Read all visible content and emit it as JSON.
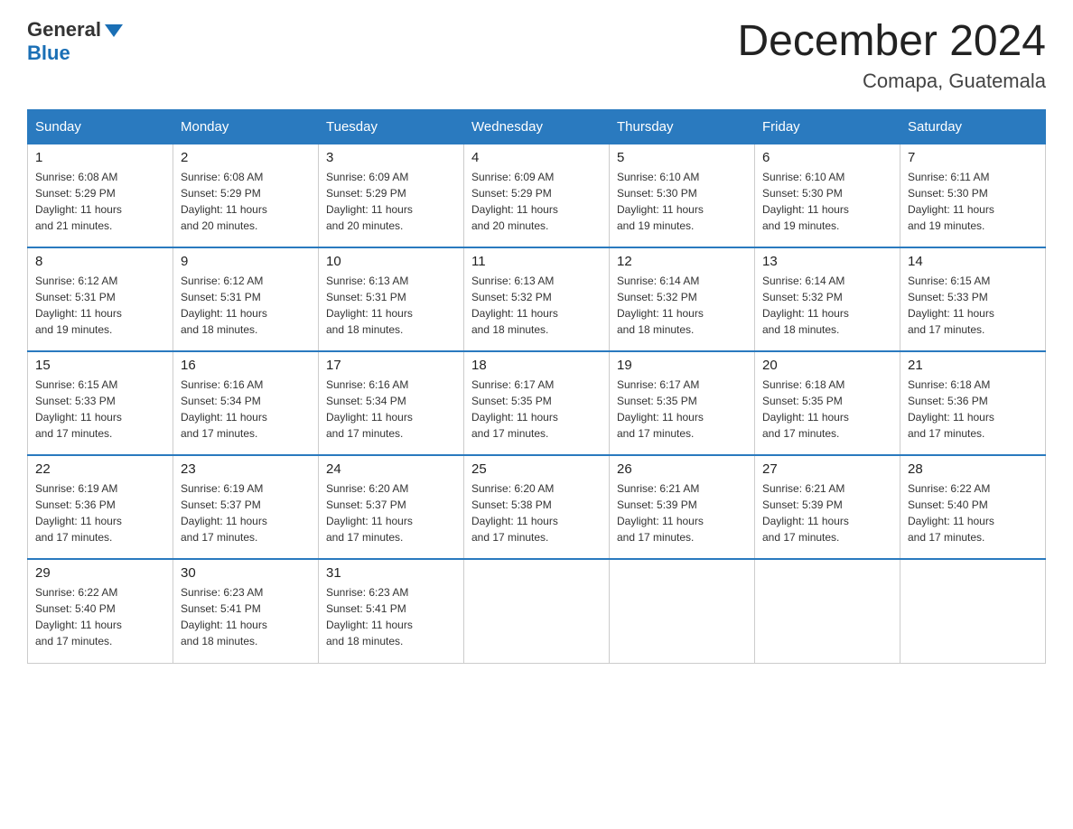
{
  "header": {
    "logo_general": "General",
    "logo_blue": "Blue",
    "month_title": "December 2024",
    "location": "Comapa, Guatemala"
  },
  "weekdays": [
    "Sunday",
    "Monday",
    "Tuesday",
    "Wednesday",
    "Thursday",
    "Friday",
    "Saturday"
  ],
  "weeks": [
    [
      {
        "day": "1",
        "sunrise": "6:08 AM",
        "sunset": "5:29 PM",
        "daylight": "11 hours and 21 minutes."
      },
      {
        "day": "2",
        "sunrise": "6:08 AM",
        "sunset": "5:29 PM",
        "daylight": "11 hours and 20 minutes."
      },
      {
        "day": "3",
        "sunrise": "6:09 AM",
        "sunset": "5:29 PM",
        "daylight": "11 hours and 20 minutes."
      },
      {
        "day": "4",
        "sunrise": "6:09 AM",
        "sunset": "5:29 PM",
        "daylight": "11 hours and 20 minutes."
      },
      {
        "day": "5",
        "sunrise": "6:10 AM",
        "sunset": "5:30 PM",
        "daylight": "11 hours and 19 minutes."
      },
      {
        "day": "6",
        "sunrise": "6:10 AM",
        "sunset": "5:30 PM",
        "daylight": "11 hours and 19 minutes."
      },
      {
        "day": "7",
        "sunrise": "6:11 AM",
        "sunset": "5:30 PM",
        "daylight": "11 hours and 19 minutes."
      }
    ],
    [
      {
        "day": "8",
        "sunrise": "6:12 AM",
        "sunset": "5:31 PM",
        "daylight": "11 hours and 19 minutes."
      },
      {
        "day": "9",
        "sunrise": "6:12 AM",
        "sunset": "5:31 PM",
        "daylight": "11 hours and 18 minutes."
      },
      {
        "day": "10",
        "sunrise": "6:13 AM",
        "sunset": "5:31 PM",
        "daylight": "11 hours and 18 minutes."
      },
      {
        "day": "11",
        "sunrise": "6:13 AM",
        "sunset": "5:32 PM",
        "daylight": "11 hours and 18 minutes."
      },
      {
        "day": "12",
        "sunrise": "6:14 AM",
        "sunset": "5:32 PM",
        "daylight": "11 hours and 18 minutes."
      },
      {
        "day": "13",
        "sunrise": "6:14 AM",
        "sunset": "5:32 PM",
        "daylight": "11 hours and 18 minutes."
      },
      {
        "day": "14",
        "sunrise": "6:15 AM",
        "sunset": "5:33 PM",
        "daylight": "11 hours and 17 minutes."
      }
    ],
    [
      {
        "day": "15",
        "sunrise": "6:15 AM",
        "sunset": "5:33 PM",
        "daylight": "11 hours and 17 minutes."
      },
      {
        "day": "16",
        "sunrise": "6:16 AM",
        "sunset": "5:34 PM",
        "daylight": "11 hours and 17 minutes."
      },
      {
        "day": "17",
        "sunrise": "6:16 AM",
        "sunset": "5:34 PM",
        "daylight": "11 hours and 17 minutes."
      },
      {
        "day": "18",
        "sunrise": "6:17 AM",
        "sunset": "5:35 PM",
        "daylight": "11 hours and 17 minutes."
      },
      {
        "day": "19",
        "sunrise": "6:17 AM",
        "sunset": "5:35 PM",
        "daylight": "11 hours and 17 minutes."
      },
      {
        "day": "20",
        "sunrise": "6:18 AM",
        "sunset": "5:35 PM",
        "daylight": "11 hours and 17 minutes."
      },
      {
        "day": "21",
        "sunrise": "6:18 AM",
        "sunset": "5:36 PM",
        "daylight": "11 hours and 17 minutes."
      }
    ],
    [
      {
        "day": "22",
        "sunrise": "6:19 AM",
        "sunset": "5:36 PM",
        "daylight": "11 hours and 17 minutes."
      },
      {
        "day": "23",
        "sunrise": "6:19 AM",
        "sunset": "5:37 PM",
        "daylight": "11 hours and 17 minutes."
      },
      {
        "day": "24",
        "sunrise": "6:20 AM",
        "sunset": "5:37 PM",
        "daylight": "11 hours and 17 minutes."
      },
      {
        "day": "25",
        "sunrise": "6:20 AM",
        "sunset": "5:38 PM",
        "daylight": "11 hours and 17 minutes."
      },
      {
        "day": "26",
        "sunrise": "6:21 AM",
        "sunset": "5:39 PM",
        "daylight": "11 hours and 17 minutes."
      },
      {
        "day": "27",
        "sunrise": "6:21 AM",
        "sunset": "5:39 PM",
        "daylight": "11 hours and 17 minutes."
      },
      {
        "day": "28",
        "sunrise": "6:22 AM",
        "sunset": "5:40 PM",
        "daylight": "11 hours and 17 minutes."
      }
    ],
    [
      {
        "day": "29",
        "sunrise": "6:22 AM",
        "sunset": "5:40 PM",
        "daylight": "11 hours and 17 minutes."
      },
      {
        "day": "30",
        "sunrise": "6:23 AM",
        "sunset": "5:41 PM",
        "daylight": "11 hours and 18 minutes."
      },
      {
        "day": "31",
        "sunrise": "6:23 AM",
        "sunset": "5:41 PM",
        "daylight": "11 hours and 18 minutes."
      },
      null,
      null,
      null,
      null
    ]
  ],
  "labels": {
    "sunrise": "Sunrise:",
    "sunset": "Sunset:",
    "daylight": "Daylight:"
  }
}
